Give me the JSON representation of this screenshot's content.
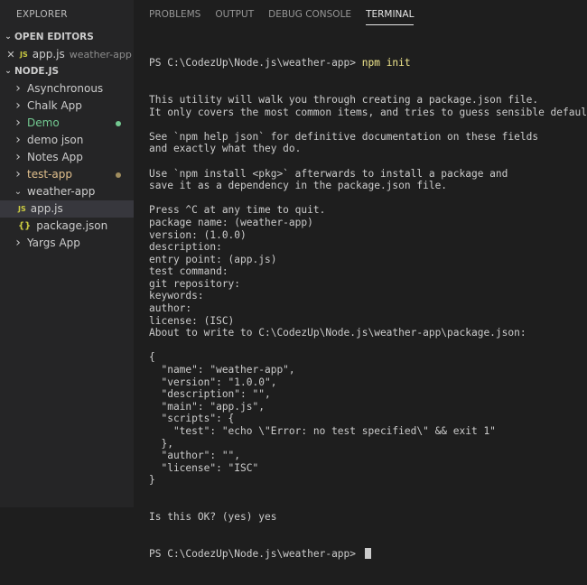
{
  "sidebar": {
    "title": "EXPLORER",
    "open_editors": {
      "header": "OPEN EDITORS",
      "item": {
        "close": "✕",
        "badge": "JS",
        "name": "app.js",
        "folder": "weather-app"
      }
    },
    "workspace": {
      "header": "NODE.JS",
      "items": [
        {
          "label": "Asynchronous",
          "color": "#cccccc"
        },
        {
          "label": "Chalk App",
          "color": "#cccccc"
        },
        {
          "label": "Demo",
          "color": "#73c991",
          "dot": "#73c991"
        },
        {
          "label": "demo json",
          "color": "#cccccc"
        },
        {
          "label": "Notes App",
          "color": "#cccccc"
        },
        {
          "label": "test-app",
          "color": "#e2c08d",
          "dot": "#a08d5e"
        },
        {
          "label": "weather-app",
          "color": "#cccccc",
          "expanded": true
        },
        {
          "label": "app.js",
          "badge": "JS",
          "selected": true
        },
        {
          "label": "package.json",
          "badge": "{}"
        },
        {
          "label": "Yargs App",
          "color": "#cccccc"
        }
      ]
    }
  },
  "panel": {
    "tabs": [
      "PROBLEMS",
      "OUTPUT",
      "DEBUG CONSOLE",
      "TERMINAL"
    ],
    "active_tab": "TERMINAL"
  },
  "terminal": {
    "prompt1": "PS C:\\CodezUp\\Node.js\\weather-app> ",
    "command1": "npm init",
    "lines": [
      "This utility will walk you through creating a package.json file.",
      "It only covers the most common items, and tries to guess sensible defaults.",
      "",
      "See `npm help json` for definitive documentation on these fields",
      "and exactly what they do.",
      "",
      "Use `npm install <pkg>` afterwards to install a package and",
      "save it as a dependency in the package.json file.",
      "",
      "Press ^C at any time to quit.",
      "package name: (weather-app)",
      "version: (1.0.0)",
      "description:",
      "entry point: (app.js)",
      "test command:",
      "git repository:",
      "keywords:",
      "author:",
      "license: (ISC)",
      "About to write to C:\\CodezUp\\Node.js\\weather-app\\package.json:",
      "",
      "{",
      "  \"name\": \"weather-app\",",
      "  \"version\": \"1.0.0\",",
      "  \"description\": \"\",",
      "  \"main\": \"app.js\",",
      "  \"scripts\": {",
      "    \"test\": \"echo \\\"Error: no test specified\\\" && exit 1\"",
      "  },",
      "  \"author\": \"\",",
      "  \"license\": \"ISC\"",
      "}",
      "",
      "",
      "Is this OK? (yes) yes"
    ],
    "final_prompt": "PS C:\\CodezUp\\Node.js\\weather-app> "
  }
}
